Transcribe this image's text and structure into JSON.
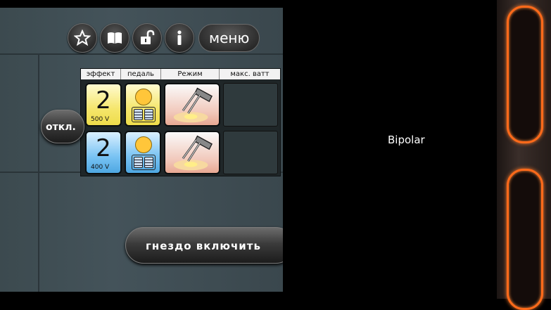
{
  "toolbar": {
    "icons": [
      "star-icon",
      "book-icon",
      "unlock-icon",
      "info-icon"
    ],
    "menu_label": "меню"
  },
  "table": {
    "columns": [
      "эффект",
      "педаль",
      "Режим",
      "макс. ватт"
    ],
    "rows": [
      {
        "effect": "2",
        "voltage": "500 V",
        "effect_color": "#f3e25a",
        "pedal_color": "#f3e25a"
      },
      {
        "effect": "2",
        "voltage": "400 V",
        "effect_color": "#5ab3ea",
        "pedal_color": "#5ab3ea"
      }
    ]
  },
  "buttons": {
    "off_label": "откл.",
    "socket_label": "гнездо включить"
  },
  "display": {
    "mode_text": "Bipolar"
  },
  "colors": {
    "accent_glow": "#ff6a1a",
    "screen_bg": "#3f4d53"
  }
}
